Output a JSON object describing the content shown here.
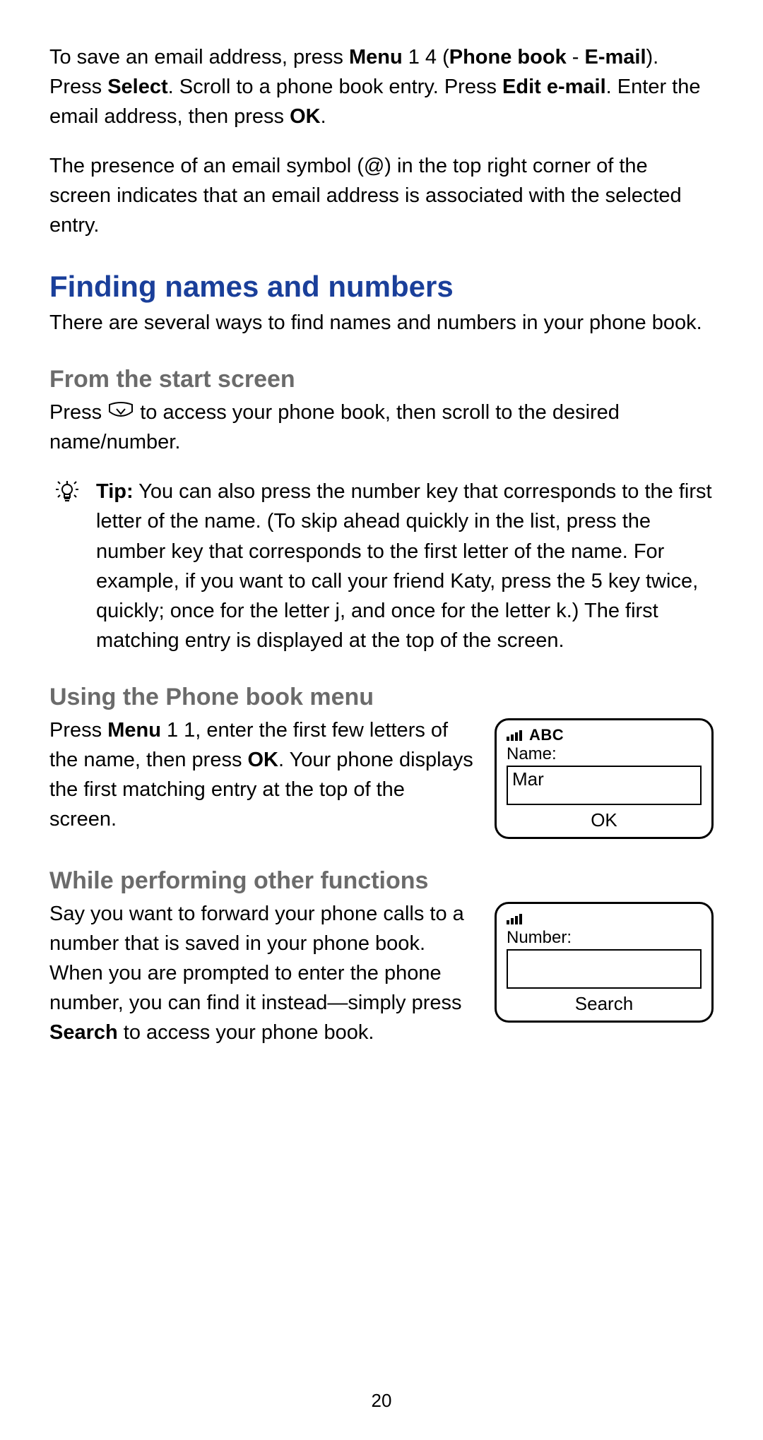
{
  "intro": {
    "p1_parts": {
      "a": "To save an email address, press ",
      "b_bold": "Menu",
      "c": " 1 4 (",
      "d_bold": "Phone book",
      "e": " - ",
      "f_bold": "E-mail",
      "g": "). Press ",
      "h_bold": "Select",
      "i": ". Scroll to a phone book entry. Press ",
      "j_bold": "Edit e-mail",
      "k": ". Enter the email address, then press ",
      "l_bold": "OK",
      "m": "."
    },
    "p2": "The presence of an email symbol (@) in the top right corner of the screen indicates that an email address is associated with the selected entry."
  },
  "heading1": "Finding names and numbers",
  "p3": "There are several ways to find names and numbers in your phone book.",
  "sectionA": {
    "title": "From the start screen",
    "text_a": "Press ",
    "text_b": " to access your phone book, then scroll to the desired name/number.",
    "tip_label": "Tip:",
    "tip_body": "  You can also press the number key that corresponds to the first letter of the name. (To skip ahead quickly in the list, press the number key that corresponds to the first letter of the name. For example, if you want to call your friend Katy, press the 5 key twice, quickly; once for the letter j, and once for the letter k.) The first matching entry is displayed at the top of the screen."
  },
  "sectionB": {
    "title": "Using the Phone book menu",
    "text_parts": {
      "a": "Press ",
      "b_bold": "Menu",
      "c": " 1 1, enter the first few letters of the name, then press ",
      "d_bold": "OK",
      "e": ". Your phone displays the first matching entry at the top of the screen."
    },
    "screen": {
      "mode": "ABC",
      "label": "Name:",
      "value": "Mar",
      "softkey": "OK"
    }
  },
  "sectionC": {
    "title": "While performing other functions",
    "text_parts": {
      "a": "Say you want to forward your phone calls to a number that is saved in your phone book. When you are prompted to enter the phone number, you can find it instead—simply press ",
      "b_bold": "Search",
      "c": " to access your phone book."
    },
    "screen": {
      "label": "Number:",
      "value": "",
      "softkey": "Search"
    }
  },
  "page_number": "20"
}
